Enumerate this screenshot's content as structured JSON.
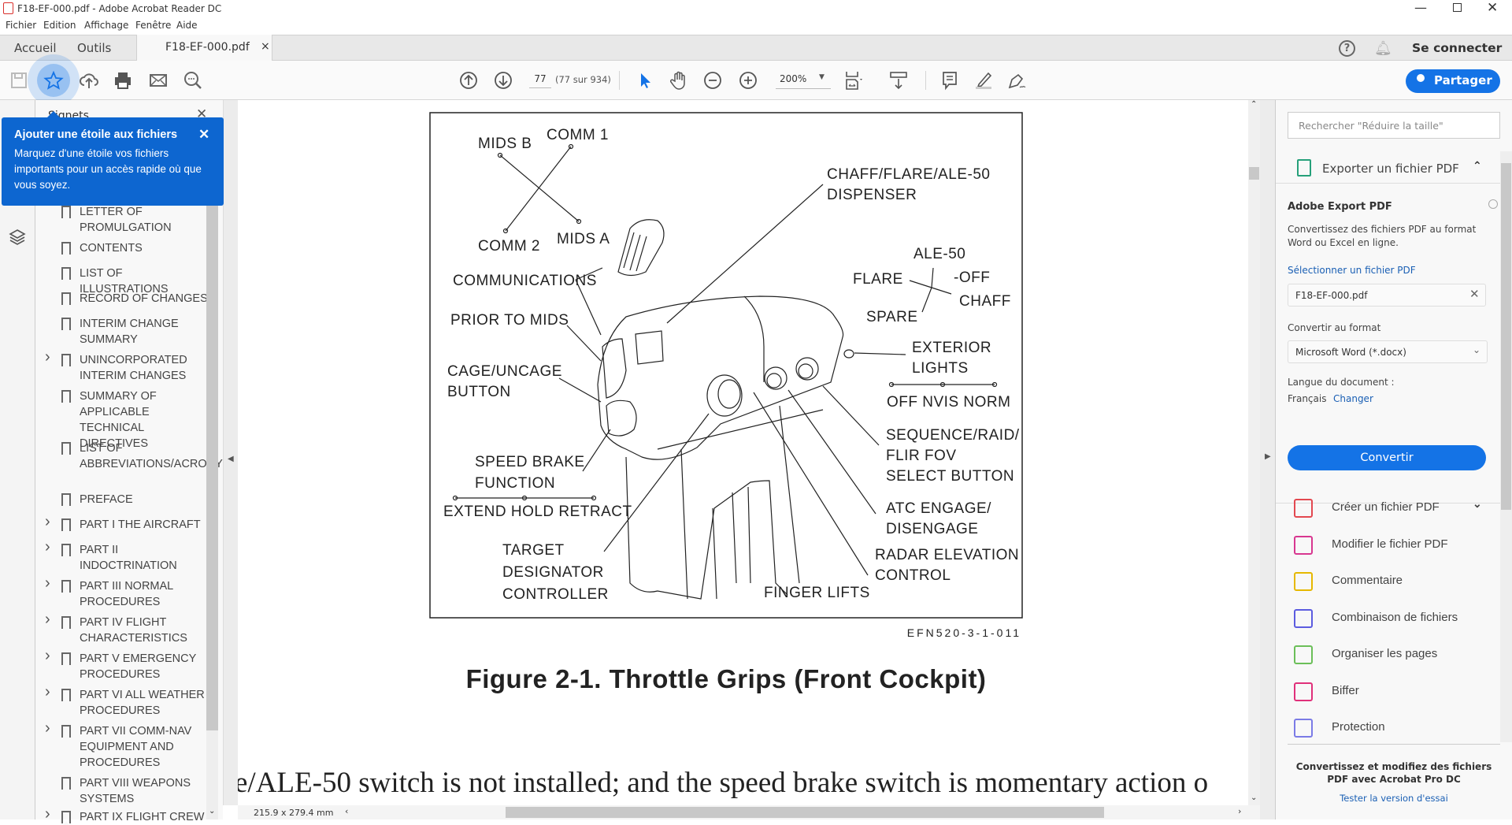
{
  "window": {
    "title": "F18-EF-000.pdf - Adobe Acrobat Reader DC"
  },
  "menu": [
    "Fichier",
    "Edition",
    "Affichage",
    "Fenêtre",
    "Aide"
  ],
  "tabs": {
    "home": "Accueil",
    "tools": "Outils",
    "document": "F18-EF-000.pdf",
    "close": "×"
  },
  "header_right": {
    "sign_in": "Se connecter",
    "share": "Partager"
  },
  "toolbar": {
    "page_current": "77",
    "page_info": "(77 sur 934)",
    "zoom": "200%"
  },
  "tooltip": {
    "title": "Ajouter une étoile aux fichiers",
    "body": "Marquez d'une étoile vos fichiers importants pour un accès rapide où que vous soyez.",
    "close": "✕"
  },
  "bookmarks": {
    "title": "Signets",
    "items": [
      {
        "label": "LETTER OF PROMULGATION",
        "expandable": false
      },
      {
        "label": "CONTENTS",
        "expandable": false
      },
      {
        "label": "LIST OF ILLUSTRATIONS",
        "expandable": false
      },
      {
        "label": "RECORD OF CHANGES",
        "expandable": false
      },
      {
        "label": "INTERIM CHANGE SUMMARY",
        "expandable": false
      },
      {
        "label": "UNINCORPORATED INTERIM CHANGES",
        "expandable": true
      },
      {
        "label": "SUMMARY OF APPLICABLE TECHNICAL DIRECTIVES",
        "expandable": false
      },
      {
        "label": "LIST OF ABBREVIATIONS/ACRONYMS",
        "expandable": false
      },
      {
        "label": "PREFACE",
        "expandable": false
      },
      {
        "label": "PART I THE AIRCRAFT",
        "expandable": true
      },
      {
        "label": "PART II INDOCTRINATION",
        "expandable": true
      },
      {
        "label": "PART III NORMAL PROCEDURES",
        "expandable": true
      },
      {
        "label": "PART IV FLIGHT CHARACTERISTICS",
        "expandable": true
      },
      {
        "label": "PART V EMERGENCY PROCEDURES",
        "expandable": true
      },
      {
        "label": "PART VI ALL WEATHER PROCEDURES",
        "expandable": true
      },
      {
        "label": "PART VII COMM-NAV EQUIPMENT AND PROCEDURES",
        "expandable": true
      },
      {
        "label": "PART VIII WEAPONS SYSTEMS",
        "expandable": false
      },
      {
        "label": "PART IX FLIGHT CREW",
        "expandable": true
      }
    ]
  },
  "document": {
    "figure_labels": {
      "mids_b": "MIDS B",
      "comm_1": "COMM 1",
      "comm_2": "COMM 2",
      "mids_a": "MIDS A",
      "chaff1": "CHAFF/FLARE/ALE-50",
      "chaff2": "DISPENSER",
      "ale50": "ALE-50",
      "flare": "FLARE",
      "off": "-OFF",
      "chaff": "CHAFF",
      "spare": "SPARE",
      "communications": "COMMUNICATIONS",
      "prior": "PRIOR TO MIDS",
      "ext1": "EXTERIOR",
      "ext2": "LIGHTS",
      "offnvis": "OFF NVIS NORM",
      "cage1": "CAGE/UNCAGE",
      "cage2": "BUTTON",
      "seq1": "SEQUENCE/RAID/",
      "seq2": "FLIR FOV",
      "seq3": "SELECT BUTTON",
      "speed1": "SPEED BRAKE",
      "speed2": "FUNCTION",
      "extend": "EXTEND HOLD RETRACT",
      "atc1": "ATC ENGAGE/",
      "atc2": "DISENGAGE",
      "radar1": "RADAR ELEVATION",
      "radar2": "CONTROL",
      "tdc1": "TARGET",
      "tdc2": "DESIGNATOR",
      "tdc3": "CONTROLLER",
      "finger": "FINGER LIFTS"
    },
    "figure_id": "EFN520-3-1-011",
    "caption": "Figure 2-1. Throttle Grips (Front Cockpit)",
    "body_line": "e/ALE-50 switch is not installed; and the speed brake switch is momentary action o",
    "page_size": "215.9 x 279.4 mm"
  },
  "right_panel": {
    "search_placeholder": "Rechercher \"Réduire la taille\"",
    "export_header": "Exporter un fichier PDF",
    "export_title": "Adobe Export PDF",
    "export_desc": "Convertissez des fichiers PDF au format Word ou Excel en ligne.",
    "select_file": "Sélectionner un fichier PDF",
    "file_name": "F18-EF-000.pdf",
    "convert_to": "Convertir au format",
    "format": "Microsoft Word (*.docx)",
    "language_label": "Langue du document :",
    "language": "Français",
    "change": "Changer",
    "convert_button": "Convertir",
    "tools": [
      "Créer un fichier PDF",
      "Modifier le fichier PDF",
      "Commentaire",
      "Combinaison de fichiers",
      "Organiser les pages",
      "Biffer",
      "Protection"
    ],
    "tool_colors": [
      "#e34850",
      "#d83790",
      "#e6b800",
      "#5c5ce0",
      "#6bbf59",
      "#e0307a",
      "#7b7be6"
    ],
    "promo": "Convertissez et modifiez des fichiers PDF avec Acrobat Pro DC",
    "trial_link": "Tester la version d'essai"
  },
  "colors": {
    "accent": "#1473e6",
    "tooltip": "#0d66d0",
    "link": "#1a5fb4"
  }
}
